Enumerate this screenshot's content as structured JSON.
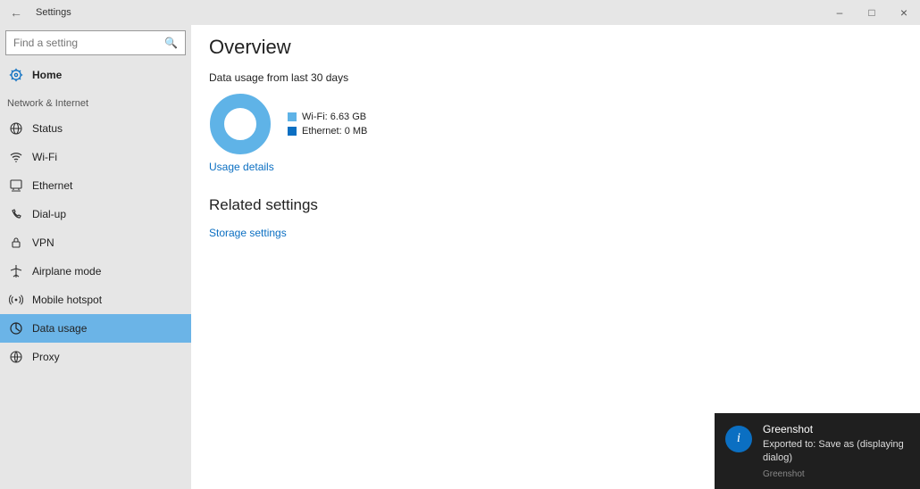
{
  "window": {
    "title": "Settings"
  },
  "search": {
    "placeholder": "Find a setting"
  },
  "home_label": "Home",
  "category": "Network & Internet",
  "nav": [
    {
      "label": "Status"
    },
    {
      "label": "Wi-Fi"
    },
    {
      "label": "Ethernet"
    },
    {
      "label": "Dial-up"
    },
    {
      "label": "VPN"
    },
    {
      "label": "Airplane mode"
    },
    {
      "label": "Mobile hotspot"
    },
    {
      "label": "Data usage"
    },
    {
      "label": "Proxy"
    }
  ],
  "page": {
    "heading": "Overview",
    "desc": "Data usage from last 30 days",
    "chart": {
      "type": "donut",
      "series": [
        {
          "name": "Wi-Fi",
          "value": 6.63,
          "unit": "GB",
          "legend": "Wi-Fi: 6.63 GB",
          "color": "#5fb3e7"
        },
        {
          "name": "Ethernet",
          "value": 0,
          "unit": "MB",
          "legend": "Ethernet: 0 MB",
          "color": "#0b6fc2"
        }
      ]
    },
    "details_link": "Usage details",
    "related_heading": "Related settings",
    "storage_link": "Storage settings"
  },
  "toast": {
    "title": "Greenshot",
    "body": "Exported to: Save as (displaying dialog)",
    "source": "Greenshot"
  },
  "chart_data": {
    "type": "pie",
    "title": "Data usage from last 30 days",
    "categories": [
      "Wi-Fi",
      "Ethernet"
    ],
    "values": [
      6.63,
      0
    ],
    "units": [
      "GB",
      "MB"
    ],
    "colors": [
      "#5fb3e7",
      "#0b6fc2"
    ]
  }
}
